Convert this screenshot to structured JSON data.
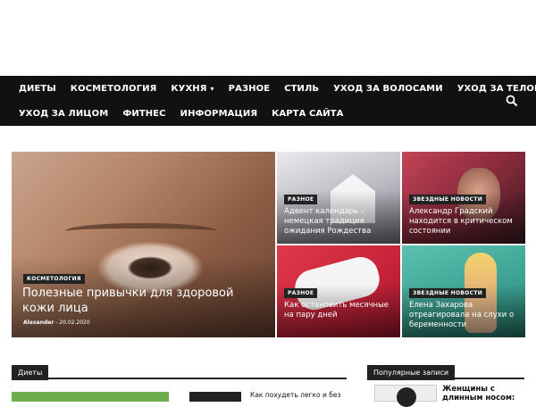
{
  "nav": {
    "row1": [
      "ДИЕТЫ",
      "КОСМЕТОЛОГИЯ",
      "КУХНЯ",
      "РАЗНОЕ",
      "СТИЛЬ",
      "УХОД ЗА ВОЛОСАМИ",
      "УХОД ЗА ТЕЛОМ"
    ],
    "row2": [
      "УХОД ЗА ЛИЦОМ",
      "ФИТНЕС",
      "ИНФОРМАЦИЯ",
      "КАРТА САЙТА"
    ],
    "kitchen_has_dropdown": true,
    "search_icon": "search-icon"
  },
  "featured": {
    "big": {
      "category": "КОСМЕТОЛОГИЯ",
      "title": "Полезные привычки для здоровой кожи лица",
      "author": "Alexander",
      "date": "20.02.2020"
    },
    "t1": {
      "category": "РАЗНОЕ",
      "title": "Адвент календарь – немецкая традиция ожидания Рождества"
    },
    "t2": {
      "category": "ЗВЕЗДНЫЕ НОВОСТИ",
      "title": "Александр Градский находится в критическом состоянии"
    },
    "t3": {
      "category": "РАЗНОЕ",
      "title": "Как остановить месячные на пару дней"
    },
    "t4": {
      "category": "ЗВЕЗДНЫЕ НОВОСТИ",
      "title": "Елена Захарова отреагировала на слухи о беременности"
    }
  },
  "sections": {
    "left_title": "Диеты",
    "right_title": "Популярные записи",
    "left_post_snippet": "Как похудеть легко и без",
    "popular_first_title": "Женщины с длинным носом:"
  },
  "colors": {
    "nav_bg": "#111111",
    "category_bg": "#222222",
    "accent_green": "#6fae4e"
  }
}
